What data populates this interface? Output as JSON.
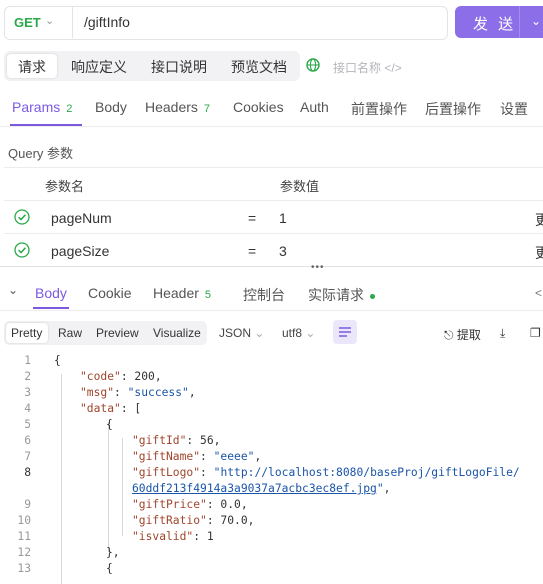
{
  "request": {
    "method": "GET",
    "url": "/giftInfo",
    "send_label": "发 送"
  },
  "subtabs": [
    "请求",
    "响应定义",
    "接口说明",
    "预览文档"
  ],
  "interface_name_placeholder": "接口名称",
  "param_tabs": [
    {
      "label": "Params",
      "badge": "2"
    },
    {
      "label": "Body",
      "badge": ""
    },
    {
      "label": "Headers",
      "badge": "7"
    },
    {
      "label": "Cookies",
      "badge": ""
    },
    {
      "label": "Auth",
      "badge": ""
    },
    {
      "label": "前置操作",
      "badge": ""
    },
    {
      "label": "后置操作",
      "badge": ""
    },
    {
      "label": "设置",
      "badge": ""
    }
  ],
  "query_label": "Query 参数",
  "table": {
    "headers": [
      "参数名",
      "参数值"
    ],
    "rows": [
      {
        "name": "pageNum",
        "op": "=",
        "value": "1",
        "trail": "更"
      },
      {
        "name": "pageSize",
        "op": "=",
        "value": "3",
        "trail": "更"
      }
    ]
  },
  "response_tabs": [
    {
      "label": "Body",
      "badge": ""
    },
    {
      "label": "Cookie",
      "badge": ""
    },
    {
      "label": "Header",
      "badge": "5"
    },
    {
      "label": "控制台",
      "badge": ""
    },
    {
      "label": "实际请求",
      "badge": ""
    }
  ],
  "formats": [
    "Pretty",
    "Raw",
    "Preview",
    "Visualize"
  ],
  "format_dropdown": "JSON",
  "encoding_dropdown": "utf8",
  "extract_label": "提取",
  "code_lines": [
    {
      "n": "1",
      "text": "{"
    },
    {
      "n": "2",
      "text": "\"code\": 200,"
    },
    {
      "n": "3",
      "text": "\"msg\": \"success\","
    },
    {
      "n": "4",
      "text": "\"data\": ["
    },
    {
      "n": "5",
      "text": "{"
    },
    {
      "n": "6",
      "text": "\"giftId\": 56,"
    },
    {
      "n": "7",
      "text": "\"giftName\": \"eeee\","
    },
    {
      "n": "8",
      "text": "\"giftLogo\": \"http://localhost:8080/baseProj/giftLogoFile/"
    },
    {
      "n": "",
      "text": "60ddf213f4914a3a9037a7acbc3ec8ef.jpg\","
    },
    {
      "n": "9",
      "text": "\"giftPrice\": 0.0,"
    },
    {
      "n": "10",
      "text": "\"giftRatio\": 70.0,"
    },
    {
      "n": "11",
      "text": "\"isvalid\": 1"
    },
    {
      "n": "12",
      "text": "},"
    },
    {
      "n": "13",
      "text": "{"
    }
  ],
  "colors": {
    "accent": "#7b5ae0",
    "send": "#8b6ee8",
    "success": "#2aa84a"
  }
}
